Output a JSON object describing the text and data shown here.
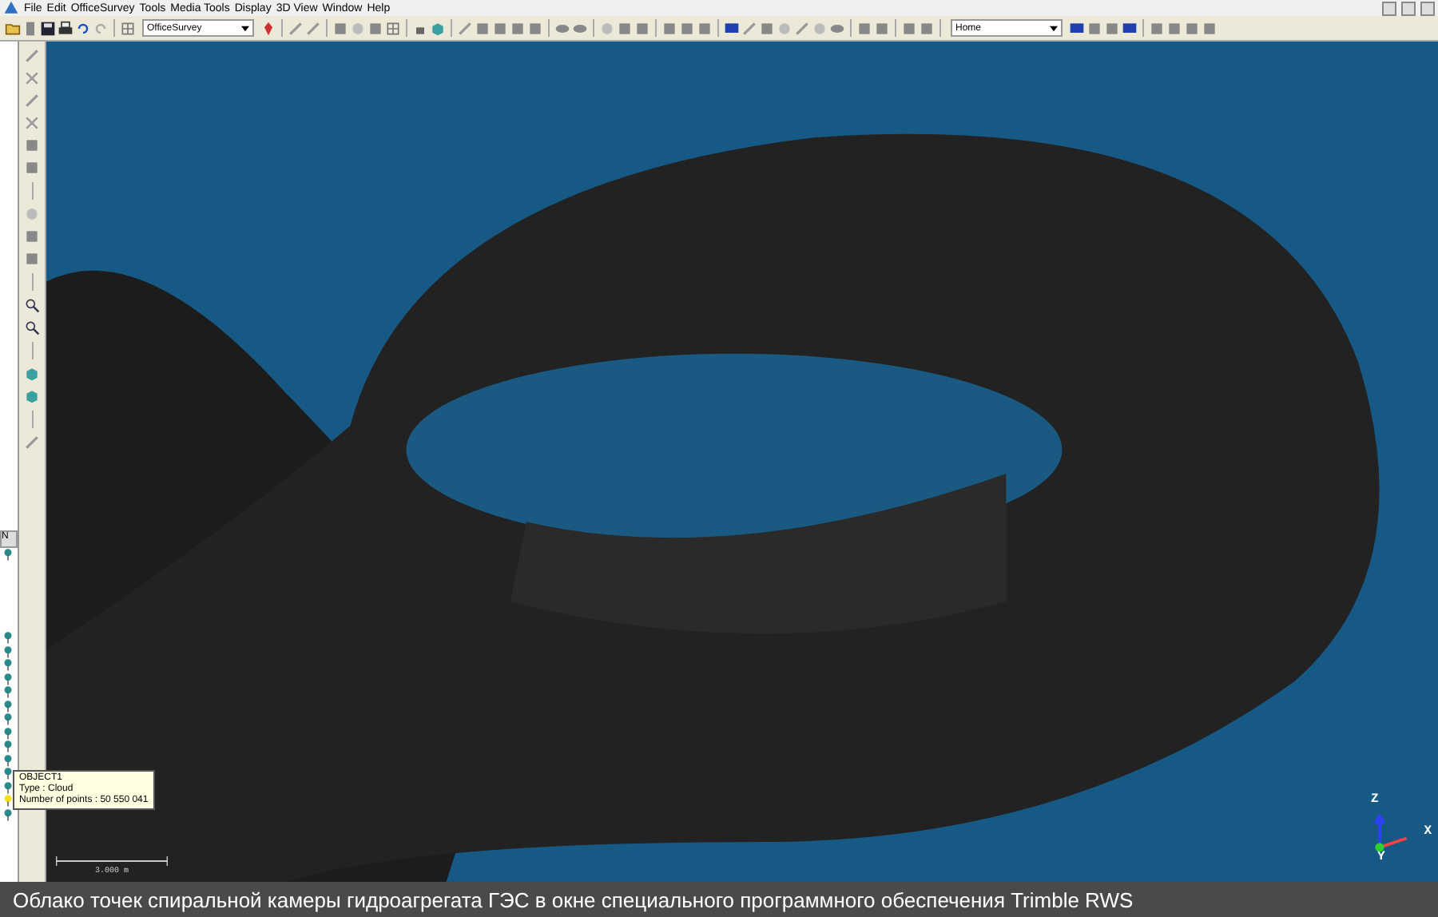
{
  "menu_bar": {
    "items": [
      "File",
      "Edit",
      "OfficeSurvey",
      "Tools",
      "Media Tools",
      "Display",
      "3D View",
      "Window",
      "Help"
    ]
  },
  "toolbar": {
    "workspace_dropdown": "OfficeSurvey",
    "view_dropdown": "Home"
  },
  "object_panel": {
    "column_header": "N",
    "items": [
      {
        "selected": false
      },
      {
        "selected": false
      },
      {
        "selected": false
      },
      {
        "selected": false
      },
      {
        "selected": false
      },
      {
        "selected": false
      },
      {
        "selected": false
      },
      {
        "selected": false
      },
      {
        "selected": false
      },
      {
        "selected": false
      },
      {
        "selected": false
      },
      {
        "selected": false
      },
      {
        "selected": false
      },
      {
        "selected": true
      },
      {
        "selected": false
      }
    ]
  },
  "tooltip": {
    "lines": [
      "OBJECT1",
      "Type : Cloud",
      "Number of points : 50 550 041"
    ]
  },
  "viewport": {
    "scale_label": "3.000 m",
    "axes": [
      "Z",
      "X",
      "Y"
    ]
  },
  "caption": "Облако точек спиральной камеры гидроагрегата ГЭС в окне специального программного обеспечения Trimble RWS"
}
